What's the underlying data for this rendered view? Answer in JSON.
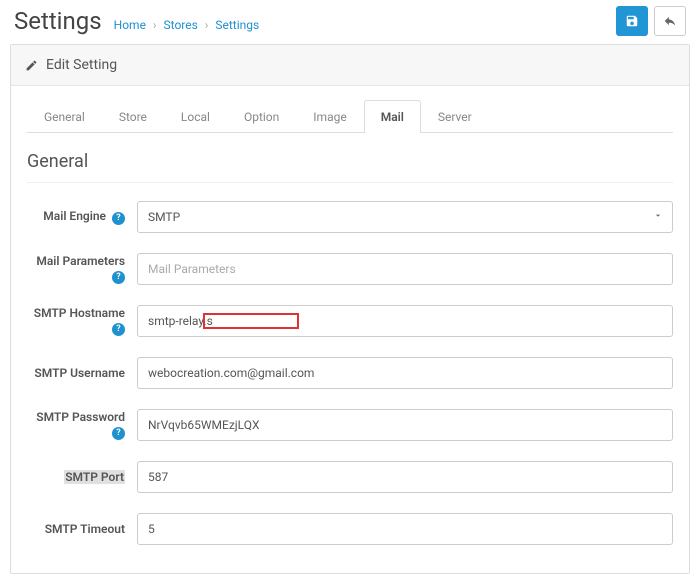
{
  "header": {
    "title": "Settings",
    "breadcrumb": {
      "home": "Home",
      "stores": "Stores",
      "settings": "Settings"
    }
  },
  "panel": {
    "title": "Edit Setting"
  },
  "tabs": {
    "general": "General",
    "store": "Store",
    "local": "Local",
    "option": "Option",
    "image": "Image",
    "mail": "Mail",
    "server": "Server"
  },
  "section": {
    "title": "General"
  },
  "labels": {
    "engine": "Mail Engine",
    "params": "Mail Parameters",
    "hostname": "SMTP Hostname",
    "username": "SMTP Username",
    "password": "SMTP Password",
    "port": "SMTP Port",
    "timeout": "SMTP Timeout"
  },
  "values": {
    "engine": "SMTP",
    "params": "",
    "hostname": "smtp-relay.s",
    "username": "webocreation.com@gmail.com",
    "password": "NrVqvb65WMEzjLQX",
    "port": "587",
    "timeout": "5"
  },
  "placeholders": {
    "params": "Mail Parameters"
  }
}
